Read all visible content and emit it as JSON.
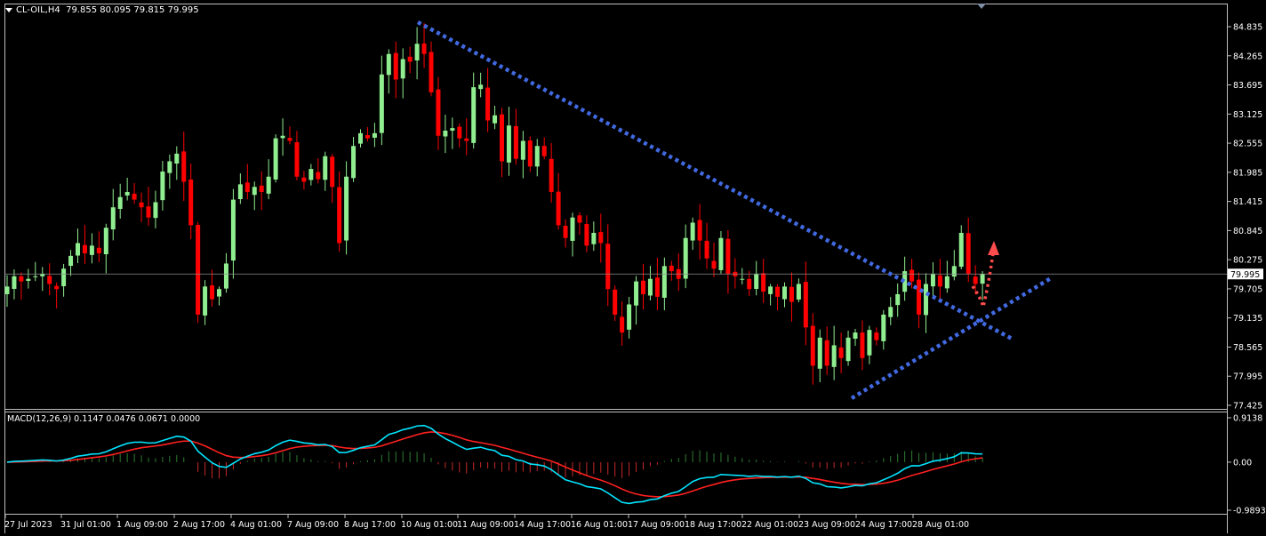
{
  "header": {
    "symbol": "CL-OIL,H4",
    "ohlc": "79.855 80.095 79.815 79.995"
  },
  "macd_header": {
    "label": "MACD(12,26,9) 0.1147 0.0476 0.0671 0.0000"
  },
  "colors": {
    "background": "#000000",
    "bull": "#90ee90",
    "bear": "#ff0000",
    "trendline": "#4169e1",
    "arrow": "#ff4d4d",
    "macd_line": "#00e5ff",
    "signal_line": "#ff2020",
    "hist_pos": "#2e7d32",
    "hist_neg": "#c62828"
  },
  "chart_data": [
    {
      "type": "candlestick",
      "title": "",
      "current_price": "79.995",
      "ylim": [
        77.425,
        84.97
      ],
      "y_ticks": [
        "84.835",
        "84.265",
        "83.695",
        "83.125",
        "82.555",
        "81.985",
        "81.415",
        "80.845",
        "80.275",
        "79.995",
        "79.705",
        "79.135",
        "78.565",
        "77.995",
        "77.425"
      ],
      "x_ticks": [
        "27 Jul 2023",
        "31 Jul 01:00",
        "1 Aug 09:00",
        "2 Aug 17:00",
        "4 Aug 01:00",
        "7 Aug 09:00",
        "8 Aug 17:00",
        "10 Aug 01:00",
        "11 Aug 09:00",
        "14 Aug 17:00",
        "16 Aug 01:00",
        "17 Aug 09:00",
        "18 Aug 17:00",
        "22 Aug 01:00",
        "23 Aug 09:00",
        "24 Aug 17:00",
        "28 Aug 01:00"
      ],
      "closes": [
        79.75,
        79.95,
        79.85,
        79.9,
        79.95,
        80.0,
        79.8,
        79.7,
        80.1,
        80.35,
        80.6,
        80.4,
        80.55,
        80.4,
        80.9,
        81.3,
        81.5,
        81.6,
        81.45,
        81.3,
        81.1,
        81.4,
        82.0,
        82.2,
        82.35,
        81.8,
        80.95,
        79.2,
        79.75,
        79.5,
        79.7,
        80.2,
        81.45,
        81.75,
        81.6,
        81.7,
        81.6,
        81.9,
        82.65,
        82.7,
        82.6,
        81.9,
        81.8,
        82.05,
        81.85,
        82.3,
        81.7,
        80.6,
        81.9,
        82.5,
        82.75,
        82.65,
        82.75,
        83.9,
        84.3,
        83.8,
        84.2,
        84.15,
        84.5,
        84.3,
        83.55,
        82.7,
        82.8,
        82.85,
        82.65,
        82.6,
        83.65,
        83.7,
        83.0,
        83.1,
        82.2,
        82.9,
        82.25,
        82.6,
        82.1,
        82.5,
        82.3,
        81.6,
        80.95,
        80.7,
        81.1,
        81.0,
        80.55,
        80.8,
        80.6,
        79.7,
        79.2,
        78.85,
        79.4,
        79.85,
        79.6,
        79.9,
        79.55,
        80.15,
        80.05,
        79.9,
        80.7,
        81.0,
        80.65,
        80.3,
        80.1,
        80.7,
        80.0,
        79.95,
        79.9,
        79.7,
        80.0,
        79.65,
        79.75,
        79.55,
        79.75,
        79.45,
        79.8,
        78.95,
        78.2,
        78.75,
        78.2,
        78.6,
        78.35,
        78.75,
        78.85,
        78.35,
        78.9,
        78.7,
        79.2,
        79.35,
        79.6,
        80.05,
        79.85,
        79.2,
        79.8,
        80.0,
        79.75,
        79.95,
        80.15,
        80.8,
        80.0,
        79.8,
        79.995
      ],
      "macd": {
        "ylim": [
          -0.9893,
          0.9138
        ],
        "y_ticks": [
          "0.9138",
          "0.00",
          "-0.9893"
        ]
      }
    }
  ]
}
